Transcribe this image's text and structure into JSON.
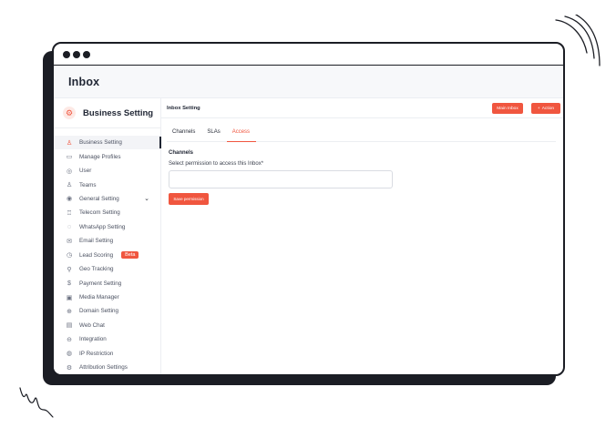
{
  "app": {
    "title": "Inbox"
  },
  "sidebar": {
    "header_title": "Business Setting",
    "items": [
      {
        "label": "Business Setting",
        "icon": "user-icon",
        "glyph": "♙",
        "active": true
      },
      {
        "label": "Manage Profiles",
        "icon": "id-card-icon",
        "glyph": "▭"
      },
      {
        "label": "User",
        "icon": "user-circle-icon",
        "glyph": "◎"
      },
      {
        "label": "Teams",
        "icon": "team-icon",
        "glyph": "♙"
      },
      {
        "label": "General Setting",
        "icon": "settings-circle-icon",
        "glyph": "◉",
        "chevron": "⌄"
      },
      {
        "label": "Telecom Setting",
        "icon": "tower-icon",
        "glyph": "♖"
      },
      {
        "label": "WhatsApp Setting",
        "icon": "whatsapp-icon",
        "glyph": "◌"
      },
      {
        "label": "Email Setting",
        "icon": "email-icon",
        "glyph": "✉"
      },
      {
        "label": "Lead Scoring",
        "icon": "gauge-icon",
        "glyph": "◷",
        "badge": "Beta"
      },
      {
        "label": "Geo Tracking",
        "icon": "geo-icon",
        "glyph": "⚲"
      },
      {
        "label": "Payment Setting",
        "icon": "dollar-icon",
        "glyph": "$"
      },
      {
        "label": "Media Manager",
        "icon": "image-icon",
        "glyph": "▣"
      },
      {
        "label": "Domain Setting",
        "icon": "globe-icon",
        "glyph": "⊕"
      },
      {
        "label": "Web Chat",
        "icon": "chat-icon",
        "glyph": "▤"
      },
      {
        "label": "Integration",
        "icon": "integration-icon",
        "glyph": "⊖"
      },
      {
        "label": "IP Restriction",
        "icon": "location-pin-icon",
        "glyph": "◍"
      },
      {
        "label": "Attribution Settings",
        "icon": "gear-icon",
        "glyph": "⚙"
      }
    ]
  },
  "main": {
    "title": "Inbox Setting",
    "main_inbox_label": "Main Inbox",
    "action_label": "Action",
    "tabs": [
      {
        "label": "Channels",
        "active": false
      },
      {
        "label": "SLAs",
        "active": false
      },
      {
        "label": "Access",
        "active": true
      }
    ],
    "section_heading": "Channels",
    "permission_label": "Select permission to access this Inbox*",
    "permission_value": "",
    "save_label": "Save permission"
  },
  "colors": {
    "accent": "#f0563f",
    "frame": "#1b1d24",
    "text": "#1f2533"
  }
}
